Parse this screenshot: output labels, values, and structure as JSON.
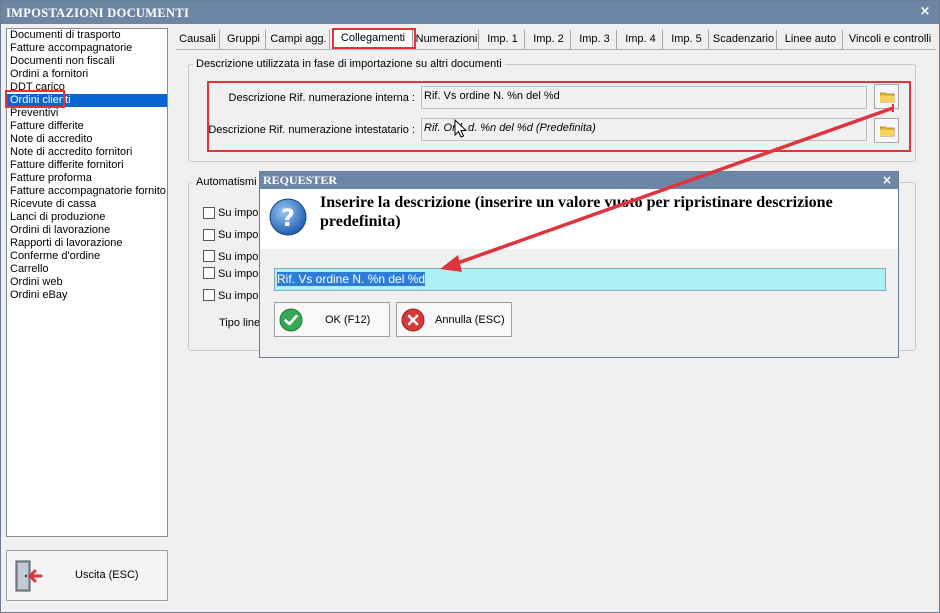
{
  "window": {
    "title": "IMPOSTAZIONI DOCUMENTI",
    "close_glyph": "×"
  },
  "left_list": {
    "items": [
      "Documenti di trasporto",
      "Fatture accompagnatorie",
      "Documenti non fiscali",
      "Ordini a fornitori",
      "DDT carico",
      "Ordini clienti",
      "Preventivi",
      "Fatture differite",
      "Note di accredito",
      "Note di accredito fornitori",
      "Fatture differite fornitori",
      "Fatture proforma",
      "Fatture accompagnatorie fornito",
      "Ricevute di cassa",
      "Lanci di produzione",
      "Ordini di lavorazione",
      "Rapporti di lavorazione",
      "Conferme d'ordine",
      "Carrello",
      "Ordini web",
      "Ordini eBay"
    ],
    "selected": "Ordini clienti"
  },
  "exit_button": {
    "label": "Uscita (ESC)",
    "icon": "exit-door-icon"
  },
  "tabs": [
    {
      "label": "Causali"
    },
    {
      "label": "Gruppi"
    },
    {
      "label": "Campi agg."
    },
    {
      "label": "Collegamenti",
      "active": true
    },
    {
      "label": "Numerazioni"
    },
    {
      "label": "Imp. 1"
    },
    {
      "label": "Imp. 2"
    },
    {
      "label": "Imp. 3"
    },
    {
      "label": "Imp. 4"
    },
    {
      "label": "Imp. 5"
    },
    {
      "label": "Scadenzario"
    },
    {
      "label": "Linee auto"
    },
    {
      "label": "Vincoli e controlli"
    }
  ],
  "group_description": {
    "title": "Descrizione utilizzata in fase di importazione su altri documenti",
    "internal_label": "Descrizione Rif. numerazione interna :",
    "internal_value": "Rif. Vs ordine  N. %n del %d",
    "holder_label": "Descrizione Rif. numerazione intestatario :",
    "holder_value": "Rif. Ord. d. %n del %d (Predefinita)"
  },
  "group_automatismi": {
    "title": "Automatismi d",
    "checkboxes": [
      "Su impor",
      "Su impor",
      "Su impor",
      "Su impor",
      "Su impor"
    ],
    "tipo_label": "Tipo linea"
  },
  "dialog": {
    "title": "REQUESTER",
    "close_glyph": "×",
    "message": "Inserire la descrizione (inserire un valore vuoto per ripristinare descrizione predefinita)",
    "input_value": "Rif. Vs ordine  N. %n del %d",
    "ok_label": "OK (F12)",
    "cancel_label": "Annulla (ESC)"
  },
  "colors": {
    "titlebar": "#6e86a6",
    "selection": "#0a64d2",
    "annotation_red": "#e0343c",
    "input_highlight": "#aef1f2"
  }
}
